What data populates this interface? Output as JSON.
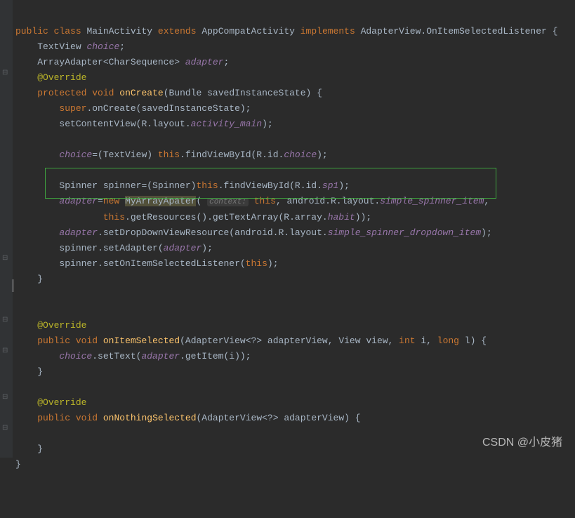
{
  "code": {
    "line1": {
      "public": "public",
      "class": "class",
      "name": "MainActivity",
      "extends": "extends",
      "parent": "AppCompatActivity",
      "implements": "implements",
      "iface": "AdapterView.OnItemSelectedListener {"
    },
    "line2": {
      "type": "TextView",
      "field": "choice",
      "semi": ";"
    },
    "line3": {
      "type": "ArrayAdapter<CharSequence>",
      "field": "adapter",
      "semi": ";"
    },
    "line4": {
      "anno": "@Override"
    },
    "line5": {
      "protected": "protected",
      "void": "void",
      "method": "onCreate",
      "params": "(Bundle savedInstanceState) {"
    },
    "line6": {
      "super": "super",
      "call": ".onCreate(savedInstanceState);"
    },
    "line7": {
      "a": "setContentView(R.layout.",
      "b": "activity_main",
      "c": ");"
    },
    "line8": {
      "a": "choice",
      "b": "=(TextView) ",
      "c": "this",
      "d": ".findViewById(R.id.",
      "e": "choice",
      "f": ");"
    },
    "line9": {
      "a": "Spinner spinner=(Spinner)",
      "b": "this",
      "c": ".findViewById(R.id.",
      "d": "sp1",
      "e": ");"
    },
    "line10": {
      "a": "adapter",
      "b": "=",
      "c": "new",
      "d": "MyArrayApater",
      "e": "(",
      "hint": "context:",
      "f": "this",
      "g": ", android.R.layout.",
      "h": "simple_spinner_item",
      "i": ","
    },
    "line11": {
      "a": "this",
      "b": ".getResources().getTextArray(R.array.",
      "c": "habit",
      "d": "));"
    },
    "line12": {
      "a": "adapter",
      "b": ".setDropDownViewResource(android.R.layout.",
      "c": "simple_spinner_dropdown_item",
      "d": ");"
    },
    "line13": {
      "a": "spinner.setAdapter(",
      "b": "adapter",
      "c": ");"
    },
    "line14": {
      "a": "spinner.setOnItemSelectedListener(",
      "b": "this",
      "c": ");"
    },
    "line15": {
      "a": "}"
    },
    "line16": {
      "anno": "@Override"
    },
    "line17": {
      "public": "public",
      "void": "void",
      "method": "onItemSelected",
      "a": "(AdapterView<?> adapterView, View view, ",
      "int": "int",
      "b": " i, ",
      "long": "long",
      "c": " l) {"
    },
    "line18": {
      "a": "choice",
      "b": ".setText(",
      "c": "adapter",
      "d": ".getItem(i));"
    },
    "line19": {
      "a": "}"
    },
    "line20": {
      "anno": "@Override"
    },
    "line21": {
      "public": "public",
      "void": "void",
      "method": "onNothingSelected",
      "a": "(AdapterView<?> adapterView) {"
    },
    "line22": {
      "a": "}"
    },
    "line23": {
      "a": "}"
    }
  },
  "watermark": "CSDN @小皮猪"
}
